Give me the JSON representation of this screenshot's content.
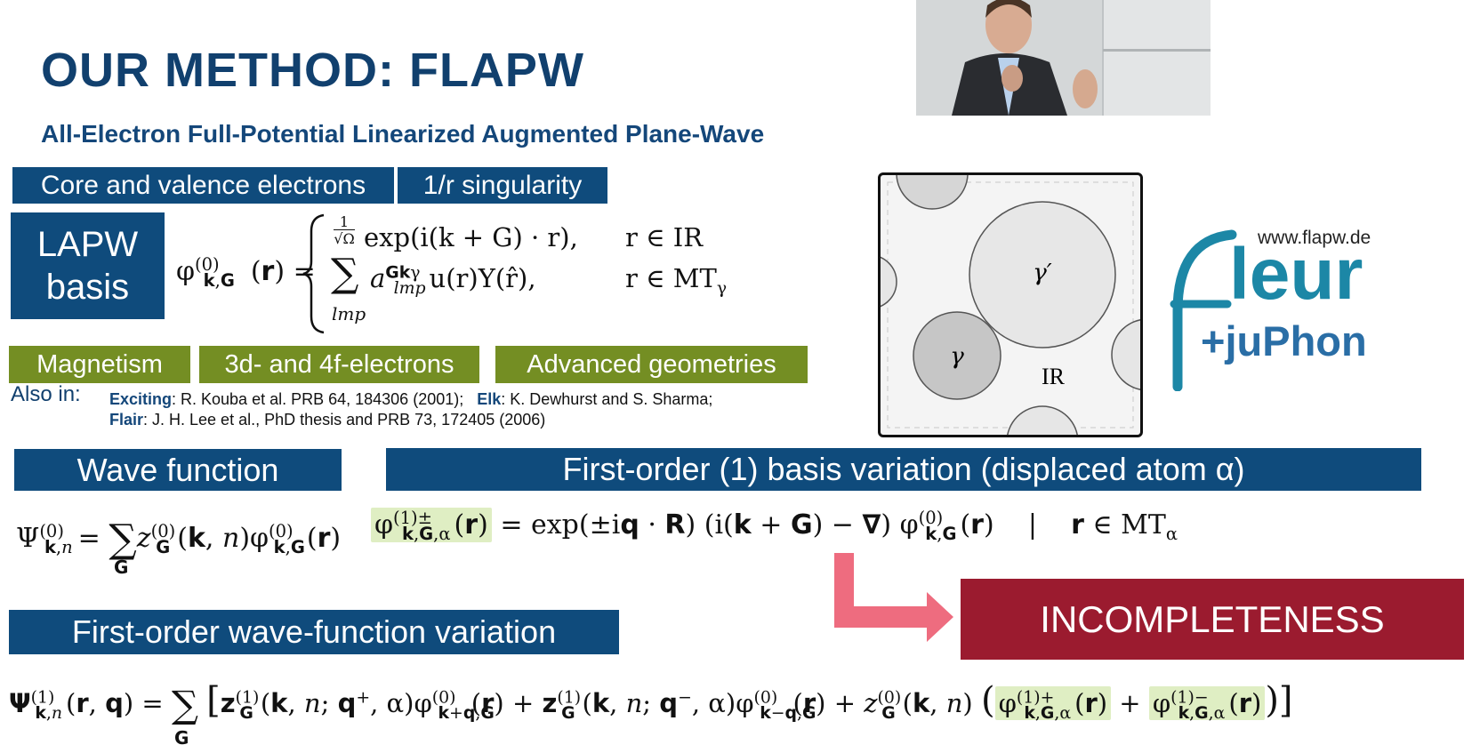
{
  "slide": {
    "title": "OUR METHOD: FLAPW",
    "subtitle": "All-Electron Full-Potential Linearized Augmented Plane-Wave"
  },
  "tags_top": [
    "Core and valence electrons",
    "1/r singularity"
  ],
  "lapw_label": [
    "LAPW",
    "basis"
  ],
  "basis_formula": {
    "lhs": "φ",
    "case1": "exp(i(k + G) · r),",
    "case1_cond": "r ∈ IR",
    "case2": "u(r)Y(r̂),",
    "case2_cond": "r ∈ MT"
  },
  "tags_mid": [
    "Magnetism",
    "3d- and 4f-electrons",
    "Advanced geometries"
  ],
  "also_in": {
    "label": "Also in:",
    "line1_code1": "Exciting",
    "line1_ref1": ": R. Kouba et al. PRB 64, 184306 (2001);",
    "line1_code2": "Elk",
    "line1_ref2": ": K. Dewhurst and S. Sharma;",
    "line2_code": "Flair",
    "line2_ref": ": J. H. Lee et al., PhD thesis and PRB 73, 172405 (2006)"
  },
  "diagram": {
    "labels": [
      "γ′",
      "γ",
      "IR"
    ]
  },
  "logo": {
    "url": "www.flapw.de",
    "name": "leur",
    "sub": "+juPhon"
  },
  "wave_function_header": "Wave function",
  "basis_variation_header": "First-order (1) basis variation (displaced atom α)",
  "wf_variation_header": "First-order wave-function variation",
  "incompleteness": "INCOMPLETENESS",
  "colors": {
    "title": "#11406e",
    "blue_box": "#0f4b7c",
    "green_box": "#748e23",
    "red_box": "#9b1b2f",
    "arrow": "#ee6c7f",
    "highlight": "#dfeec3"
  }
}
